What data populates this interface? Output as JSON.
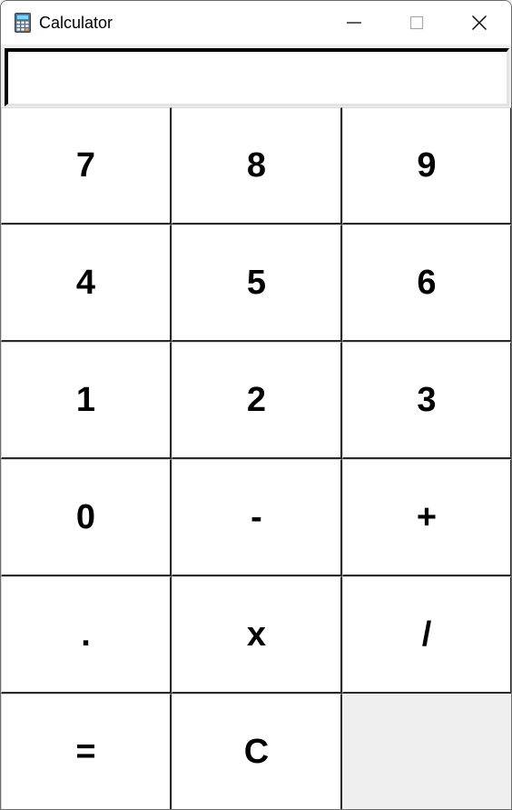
{
  "window": {
    "title": "Calculator",
    "icon": "calculator-icon",
    "controls": {
      "minimize_icon": "minimize-icon",
      "maximize_icon": "maximize-icon",
      "close_icon": "close-icon"
    }
  },
  "display": {
    "value": ""
  },
  "keys": {
    "k7": "7",
    "k8": "8",
    "k9": "9",
    "k4": "4",
    "k5": "5",
    "k6": "6",
    "k1": "1",
    "k2": "2",
    "k3": "3",
    "k0": "0",
    "minus": "-",
    "plus": "+",
    "dot": ".",
    "multiply": "x",
    "divide": "/",
    "equals": "=",
    "clear": "C"
  },
  "colors": {
    "titlebar": "#ffffff",
    "window_bg": "#f0f0f0",
    "key_bg": "#ffffff",
    "key_border": "#2a2a2a",
    "display_border_dark": "#000000"
  }
}
